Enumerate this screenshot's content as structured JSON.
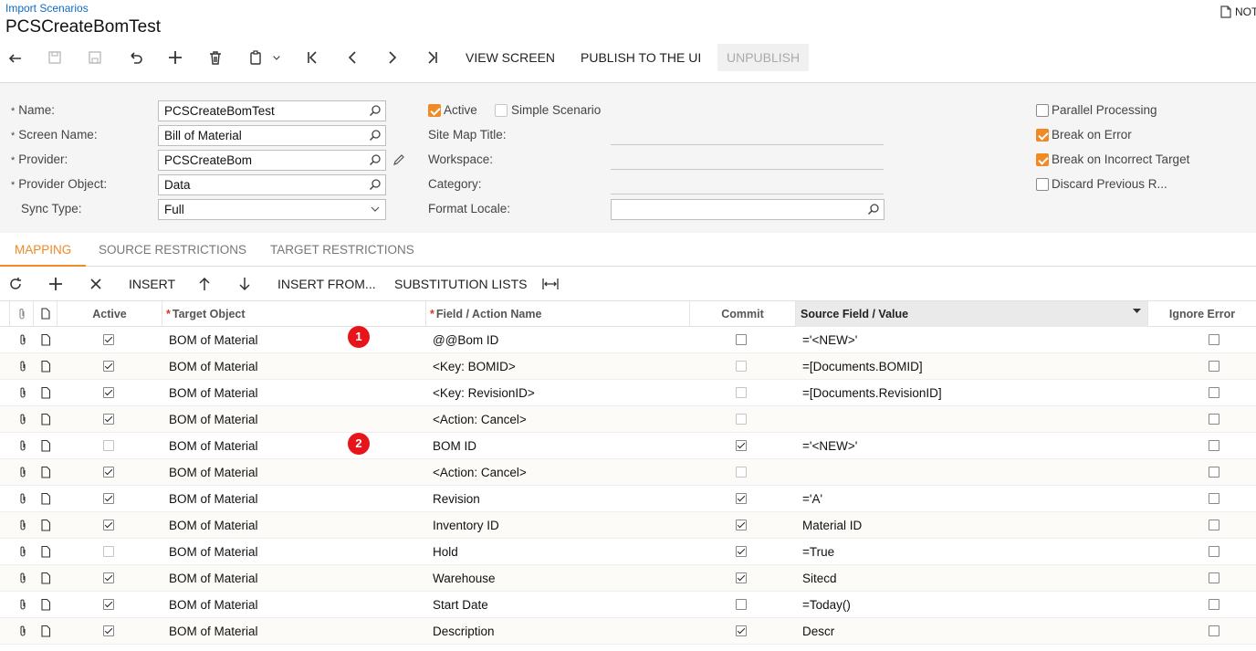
{
  "header": {
    "breadcrumb": "Import Scenarios",
    "title": "PCSCreateBomTest",
    "notes_label": "NOT"
  },
  "toolbar": {
    "icons": [
      "back-icon",
      "save-disabled-icon",
      "save-close-disabled-icon",
      "undo-icon",
      "add-icon",
      "delete-icon",
      "copy-paste-icon",
      "chevron-down-icon",
      "first-record-icon",
      "prev-record-icon",
      "next-record-icon",
      "last-record-icon"
    ],
    "view_screen": "VIEW SCREEN",
    "publish": "PUBLISH TO THE UI",
    "unpublish": "UNPUBLISH"
  },
  "form": {
    "name_label": "Name:",
    "name_value": "PCSCreateBomTest",
    "screen_name_label": "Screen Name:",
    "screen_name_value": "Bill of Material",
    "provider_label": "Provider:",
    "provider_value": "PCSCreateBom",
    "provider_object_label": "Provider Object:",
    "provider_object_value": "Data",
    "sync_type_label": "Sync Type:",
    "sync_type_value": "Full",
    "active_label": "Active",
    "active_checked": true,
    "simple_scenario_label": "Simple Scenario",
    "simple_scenario_checked": false,
    "site_map_title_label": "Site Map Title:",
    "workspace_label": "Workspace:",
    "category_label": "Category:",
    "format_locale_label": "Format Locale:",
    "parallel_processing_label": "Parallel Processing",
    "parallel_processing_checked": false,
    "break_on_error_label": "Break on Error",
    "break_on_error_checked": true,
    "break_on_incorrect_target_label": "Break on Incorrect Target",
    "break_on_incorrect_target_checked": true,
    "discard_previous_label": "Discard Previous R...",
    "discard_previous_checked": false,
    "accent_color": "#f08a24"
  },
  "tabs": [
    "MAPPING",
    "SOURCE RESTRICTIONS",
    "TARGET RESTRICTIONS"
  ],
  "grid_toolbar": {
    "insert": "INSERT",
    "insert_from": "INSERT FROM...",
    "substitution_lists": "SUBSTITUTION LISTS"
  },
  "grid": {
    "columns": {
      "active": "Active",
      "target_object": "Target Object",
      "field_action": "Field / Action Name",
      "commit": "Commit",
      "source_field": "Source Field / Value",
      "ignore_error": "Ignore Error"
    },
    "rows": [
      {
        "active": true,
        "target": "BOM of Material",
        "field": "@@Bom ID",
        "commit": false,
        "commit_enabled": true,
        "source": "='<NEW>'",
        "ignore": false
      },
      {
        "active": true,
        "target": "BOM of Material",
        "field": "<Key: BOMID>",
        "commit": false,
        "commit_enabled": false,
        "source": "=[Documents.BOMID]",
        "ignore": false
      },
      {
        "active": true,
        "target": "BOM of Material",
        "field": "<Key: RevisionID>",
        "commit": false,
        "commit_enabled": false,
        "source": "=[Documents.RevisionID]",
        "ignore": false
      },
      {
        "active": true,
        "target": "BOM of Material",
        "field": "<Action: Cancel>",
        "commit": false,
        "commit_enabled": false,
        "source": "",
        "ignore": false
      },
      {
        "active": false,
        "target": "BOM of Material",
        "field": "BOM ID",
        "commit": true,
        "commit_enabled": true,
        "source": "='<NEW>'",
        "ignore": false
      },
      {
        "active": true,
        "target": "BOM of Material",
        "field": "<Action: Cancel>",
        "commit": false,
        "commit_enabled": false,
        "source": "",
        "ignore": false
      },
      {
        "active": true,
        "target": "BOM of Material",
        "field": "Revision",
        "commit": true,
        "commit_enabled": true,
        "source": "='A'",
        "ignore": false
      },
      {
        "active": true,
        "target": "BOM of Material",
        "field": "Inventory ID",
        "commit": true,
        "commit_enabled": true,
        "source": "Material ID",
        "ignore": false
      },
      {
        "active": false,
        "target": "BOM of Material",
        "field": "Hold",
        "commit": true,
        "commit_enabled": true,
        "source": "=True",
        "ignore": false
      },
      {
        "active": true,
        "target": "BOM of Material",
        "field": "Warehouse",
        "commit": true,
        "commit_enabled": true,
        "source": "Sitecd",
        "ignore": false
      },
      {
        "active": true,
        "target": "BOM of Material",
        "field": "Start Date",
        "commit": false,
        "commit_enabled": true,
        "source": "=Today()",
        "ignore": false
      },
      {
        "active": true,
        "target": "BOM of Material",
        "field": "Description",
        "commit": true,
        "commit_enabled": true,
        "source": "Descr",
        "ignore": false
      }
    ]
  },
  "annotations": [
    "1",
    "2"
  ]
}
